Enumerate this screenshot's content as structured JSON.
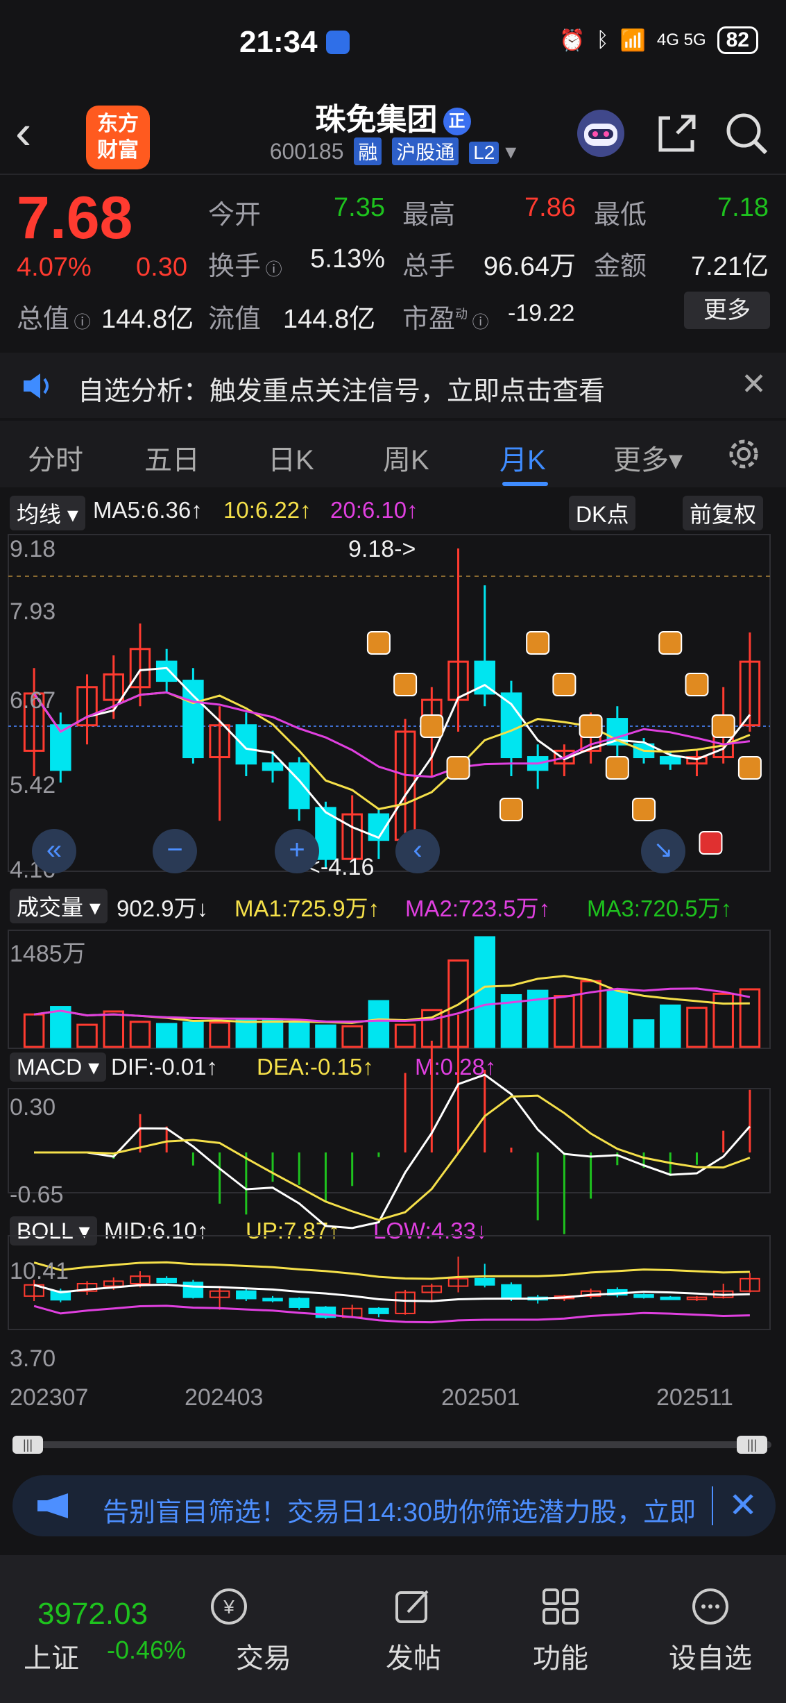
{
  "status_bar": {
    "time": "21:34",
    "battery": "82",
    "signal": "4G 5G"
  },
  "header": {
    "logo_text_1": "东方",
    "logo_text_2": "财富",
    "stock_name": "珠免集团",
    "badge": "正",
    "code": "600185",
    "tag_rong": "融",
    "tag_hgt": "沪股通",
    "tag_l2": "L2"
  },
  "quote": {
    "price": "7.68",
    "change_pct": "4.07%",
    "change": "0.30",
    "open_label": "今开",
    "open": "7.35",
    "high_label": "最高",
    "high": "7.86",
    "low_label": "最低",
    "low": "7.18",
    "turnover_label": "换手",
    "turnover": "5.13%",
    "volume_label": "总手",
    "volume": "96.64万",
    "amount_label": "金额",
    "amount": "7.21亿",
    "mcap_label": "总值",
    "mcap": "144.8亿",
    "float_label": "流值",
    "float": "144.8亿",
    "pe_label": "市盈",
    "pe_sup": "动",
    "pe": "-19.22",
    "more": "更多"
  },
  "notice": {
    "text": "自选分析：触发重点关注信号，立即点击查看"
  },
  "tabs": [
    "分时",
    "五日",
    "日K",
    "周K",
    "月K",
    "更多▾"
  ],
  "active_tab": "月K",
  "kline_panel": {
    "indicator": "均线",
    "ma5": "MA5:6.36↑",
    "ma10": "10:6.22↑",
    "ma20": "20:6.10↑",
    "dk_button": "DK点",
    "adjust_button": "前复权",
    "y_labels": [
      "9.18",
      "7.93",
      "6.67",
      "5.42",
      "4.16"
    ],
    "max_marker": "9.18->",
    "min_marker": "<-4.16",
    "colors": {
      "up": "#ff3b30",
      "down": "#00e5f0",
      "ma5": "#ffffff",
      "ma10": "#f5e04a",
      "ma20": "#e040e0"
    }
  },
  "volume_panel": {
    "indicator": "成交量",
    "current": "902.9万↓",
    "ma1": "MA1:725.9万↑",
    "ma2": "MA2:723.5万↑",
    "ma3": "MA3:720.5万↑",
    "y_max": "1485万"
  },
  "macd_panel": {
    "indicator": "MACD",
    "dif": "DIF:-0.01↑",
    "dea": "DEA:-0.15↑",
    "m": "M:0.28↑",
    "y_top": "0.30",
    "y_bottom": "-0.65"
  },
  "boll_panel": {
    "indicator": "BOLL",
    "mid": "MID:6.10↑",
    "up": "UP:7.87↑",
    "low": "LOW:4.33↓",
    "y_top": "10.41",
    "y_bottom": "3.70"
  },
  "x_axis": [
    "202307",
    "202403",
    "202501",
    "202511"
  ],
  "banner": {
    "text": "告别盲目筛选！交易日14:30助你筛选潜力股，立即"
  },
  "bottom_nav": {
    "index_value": "3972.03",
    "index_name": "上证",
    "index_pct": "-0.46%",
    "items": [
      "交易",
      "发帖",
      "功能",
      "设自选"
    ]
  },
  "chart_data": {
    "type": "candlestick",
    "candles": [
      {
        "o": 6.0,
        "c": 6.9,
        "h": 7.3,
        "l": 5.6
      },
      {
        "o": 6.4,
        "c": 5.7,
        "h": 6.6,
        "l": 5.5
      },
      {
        "o": 6.4,
        "c": 7.0,
        "h": 7.2,
        "l": 6.1
      },
      {
        "o": 6.8,
        "c": 7.2,
        "h": 7.5,
        "l": 6.5
      },
      {
        "o": 7.0,
        "c": 7.6,
        "h": 8.0,
        "l": 6.7
      },
      {
        "o": 7.4,
        "c": 7.1,
        "h": 7.6,
        "l": 6.9
      },
      {
        "o": 7.1,
        "c": 5.9,
        "h": 7.3,
        "l": 5.8
      },
      {
        "o": 5.9,
        "c": 6.4,
        "h": 6.7,
        "l": 4.9
      },
      {
        "o": 6.4,
        "c": 5.8,
        "h": 6.6,
        "l": 5.6
      },
      {
        "o": 5.8,
        "c": 5.7,
        "h": 6.0,
        "l": 5.5
      },
      {
        "o": 5.8,
        "c": 5.1,
        "h": 5.9,
        "l": 4.9
      },
      {
        "o": 5.1,
        "c": 4.3,
        "h": 5.2,
        "l": 4.16
      },
      {
        "o": 4.3,
        "c": 5.0,
        "h": 5.3,
        "l": 4.3
      },
      {
        "o": 5.0,
        "c": 4.6,
        "h": 5.1,
        "l": 4.3
      },
      {
        "o": 4.6,
        "c": 6.3,
        "h": 6.5,
        "l": 4.5
      },
      {
        "o": 6.3,
        "c": 6.8,
        "h": 7.0,
        "l": 5.6
      },
      {
        "o": 6.8,
        "c": 7.4,
        "h": 9.18,
        "l": 6.3
      },
      {
        "o": 7.4,
        "c": 6.9,
        "h": 8.6,
        "l": 6.7
      },
      {
        "o": 6.9,
        "c": 5.9,
        "h": 7.1,
        "l": 5.6
      },
      {
        "o": 5.9,
        "c": 5.7,
        "h": 6.1,
        "l": 5.4
      },
      {
        "o": 5.8,
        "c": 6.0,
        "h": 6.1,
        "l": 5.6
      },
      {
        "o": 6.0,
        "c": 6.4,
        "h": 6.6,
        "l": 5.8
      },
      {
        "o": 6.5,
        "c": 6.1,
        "h": 6.7,
        "l": 5.9
      },
      {
        "o": 6.1,
        "c": 5.9,
        "h": 6.2,
        "l": 5.8
      },
      {
        "o": 5.9,
        "c": 5.8,
        "h": 6.0,
        "l": 5.7
      },
      {
        "o": 5.8,
        "c": 5.9,
        "h": 6.0,
        "l": 5.6
      },
      {
        "o": 5.9,
        "c": 6.4,
        "h": 7.0,
        "l": 5.8
      },
      {
        "o": 6.4,
        "c": 7.4,
        "h": 7.86,
        "l": 6.3
      }
    ],
    "volume": [
      440,
      540,
      300,
      480,
      340,
      310,
      330,
      330,
      380,
      360,
      320,
      290,
      280,
      620,
      300,
      500,
      1170,
      1485,
      700,
      760,
      690,
      890,
      760,
      360,
      560,
      530,
      720,
      780
    ],
    "ylim": [
      4.16,
      9.18
    ]
  }
}
